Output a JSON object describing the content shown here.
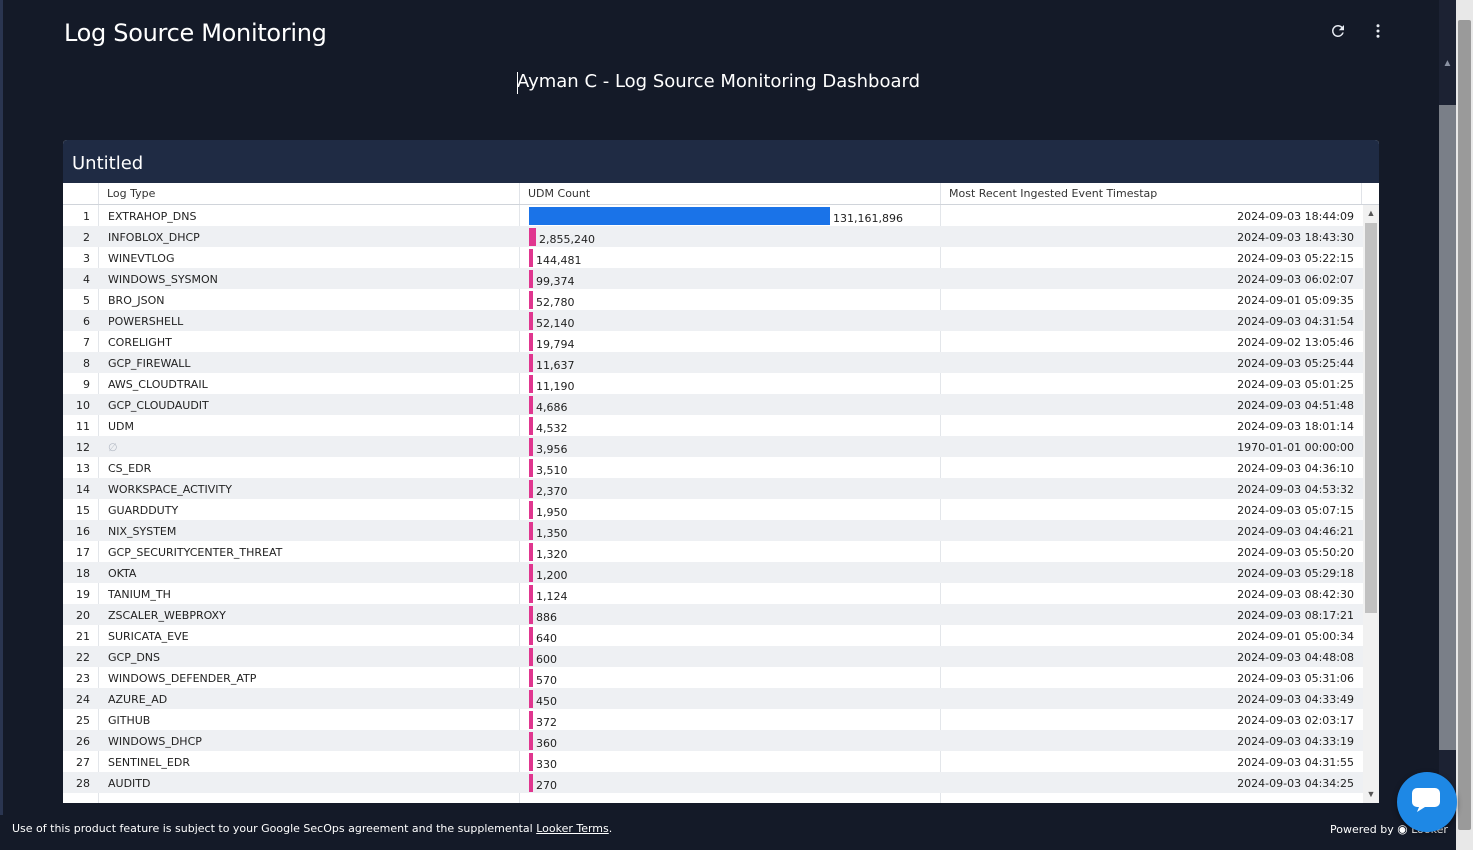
{
  "page_title": "Log Source Monitoring",
  "dashboard_title": "Ayman C - Log Source Monitoring Dashboard",
  "icons": {
    "refresh": "refresh-icon",
    "menu": "more-vert-icon",
    "chat": "chat-icon"
  },
  "tile": {
    "title": "Untitled",
    "columns": [
      "Log Type",
      "UDM Count",
      "Most Recent Ingested Event Timestap"
    ],
    "bar_colors": {
      "top": "#1a73e8",
      "other": "#e0368f"
    },
    "max_count": 131161896,
    "rows": [
      {
        "n": "1",
        "type": "EXTRAHOP_DNS",
        "count": "131,161,896",
        "raw": 131161896,
        "ts": "2024-09-03 18:44:09"
      },
      {
        "n": "2",
        "type": "INFOBLOX_DHCP",
        "count": "2,855,240",
        "raw": 2855240,
        "ts": "2024-09-03 18:43:30"
      },
      {
        "n": "3",
        "type": "WINEVTLOG",
        "count": "144,481",
        "raw": 144481,
        "ts": "2024-09-03 05:22:15"
      },
      {
        "n": "4",
        "type": "WINDOWS_SYSMON",
        "count": "99,374",
        "raw": 99374,
        "ts": "2024-09-03 06:02:07"
      },
      {
        "n": "5",
        "type": "BRO_JSON",
        "count": "52,780",
        "raw": 52780,
        "ts": "2024-09-01 05:09:35"
      },
      {
        "n": "6",
        "type": "POWERSHELL",
        "count": "52,140",
        "raw": 52140,
        "ts": "2024-09-03 04:31:54"
      },
      {
        "n": "7",
        "type": "CORELIGHT",
        "count": "19,794",
        "raw": 19794,
        "ts": "2024-09-02 13:05:46"
      },
      {
        "n": "8",
        "type": "GCP_FIREWALL",
        "count": "11,637",
        "raw": 11637,
        "ts": "2024-09-03 05:25:44"
      },
      {
        "n": "9",
        "type": "AWS_CLOUDTRAIL",
        "count": "11,190",
        "raw": 11190,
        "ts": "2024-09-03 05:01:25"
      },
      {
        "n": "10",
        "type": "GCP_CLOUDAUDIT",
        "count": "4,686",
        "raw": 4686,
        "ts": "2024-09-03 04:51:48"
      },
      {
        "n": "11",
        "type": "UDM",
        "count": "4,532",
        "raw": 4532,
        "ts": "2024-09-03 18:01:14"
      },
      {
        "n": "12",
        "type": "∅",
        "count": "3,956",
        "raw": 3956,
        "ts": "1970-01-01 00:00:00",
        "null": true
      },
      {
        "n": "13",
        "type": "CS_EDR",
        "count": "3,510",
        "raw": 3510,
        "ts": "2024-09-03 04:36:10"
      },
      {
        "n": "14",
        "type": "WORKSPACE_ACTIVITY",
        "count": "2,370",
        "raw": 2370,
        "ts": "2024-09-03 04:53:32"
      },
      {
        "n": "15",
        "type": "GUARDDUTY",
        "count": "1,950",
        "raw": 1950,
        "ts": "2024-09-03 05:07:15"
      },
      {
        "n": "16",
        "type": "NIX_SYSTEM",
        "count": "1,350",
        "raw": 1350,
        "ts": "2024-09-03 04:46:21"
      },
      {
        "n": "17",
        "type": "GCP_SECURITYCENTER_THREAT",
        "count": "1,320",
        "raw": 1320,
        "ts": "2024-09-03 05:50:20"
      },
      {
        "n": "18",
        "type": "OKTA",
        "count": "1,200",
        "raw": 1200,
        "ts": "2024-09-03 05:29:18"
      },
      {
        "n": "19",
        "type": "TANIUM_TH",
        "count": "1,124",
        "raw": 1124,
        "ts": "2024-09-03 08:42:30"
      },
      {
        "n": "20",
        "type": "ZSCALER_WEBPROXY",
        "count": "886",
        "raw": 886,
        "ts": "2024-09-03 08:17:21"
      },
      {
        "n": "21",
        "type": "SURICATA_EVE",
        "count": "640",
        "raw": 640,
        "ts": "2024-09-01 05:00:34"
      },
      {
        "n": "22",
        "type": "GCP_DNS",
        "count": "600",
        "raw": 600,
        "ts": "2024-09-03 04:48:08"
      },
      {
        "n": "23",
        "type": "WINDOWS_DEFENDER_ATP",
        "count": "570",
        "raw": 570,
        "ts": "2024-09-03 05:31:06"
      },
      {
        "n": "24",
        "type": "AZURE_AD",
        "count": "450",
        "raw": 450,
        "ts": "2024-09-03 04:33:49"
      },
      {
        "n": "25",
        "type": "GITHUB",
        "count": "372",
        "raw": 372,
        "ts": "2024-09-03 02:03:17"
      },
      {
        "n": "26",
        "type": "WINDOWS_DHCP",
        "count": "360",
        "raw": 360,
        "ts": "2024-09-03 04:33:19"
      },
      {
        "n": "27",
        "type": "SENTINEL_EDR",
        "count": "330",
        "raw": 330,
        "ts": "2024-09-03 04:31:55"
      },
      {
        "n": "28",
        "type": "AUDITD",
        "count": "270",
        "raw": 270,
        "ts": "2024-09-03 04:34:25"
      }
    ]
  },
  "footer": {
    "disclaimer_prefix": "Use of this product feature is subject to your Google SecOps agreement and the supplemental ",
    "terms_link": "Looker Terms",
    "disclaimer_suffix": ".",
    "powered_by": "Powered by",
    "brand": "Looker"
  }
}
